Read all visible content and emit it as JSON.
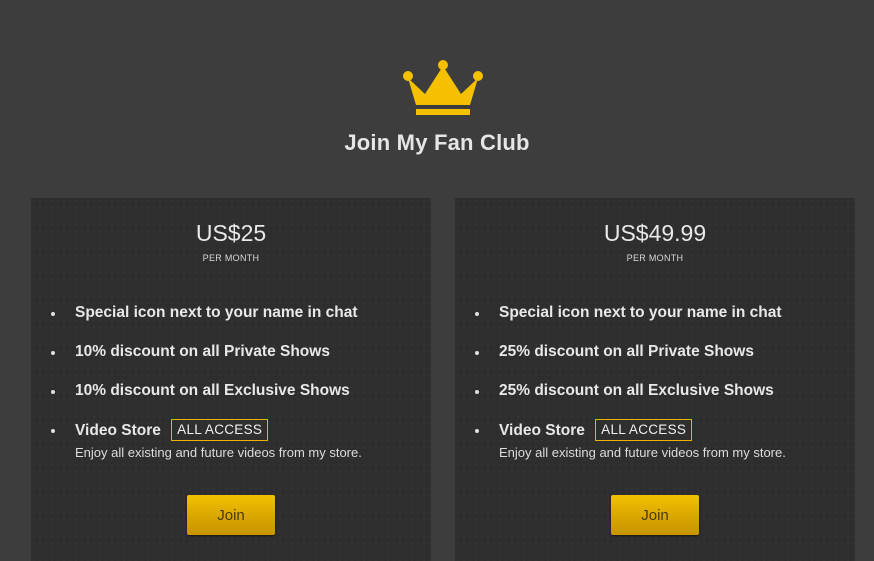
{
  "header": {
    "crown_icon": "crown-icon",
    "crown_color": "#f5c000",
    "title": "Join My Fan Club"
  },
  "plans": [
    {
      "price": "US$25",
      "period": "PER MONTH",
      "features": [
        "Special icon next to your name in chat",
        "10% discount on all Private Shows",
        "10% discount on all Exclusive Shows"
      ],
      "store": {
        "label": "Video Store",
        "badge": "ALL ACCESS",
        "note": "Enjoy all existing and future videos from my store."
      },
      "button": "Join"
    },
    {
      "price": "US$49.99",
      "period": "PER MONTH",
      "features": [
        "Special icon next to your name in chat",
        "25% discount on all Private Shows",
        "25% discount on all Exclusive Shows"
      ],
      "store": {
        "label": "Video Store",
        "badge": "ALL ACCESS",
        "note": "Enjoy all existing and future videos from my store."
      },
      "button": "Join"
    }
  ],
  "colors": {
    "background": "#3d3d3d",
    "card": "#2e2e2e",
    "accent": "#e8b400",
    "button": "#d9a600"
  }
}
